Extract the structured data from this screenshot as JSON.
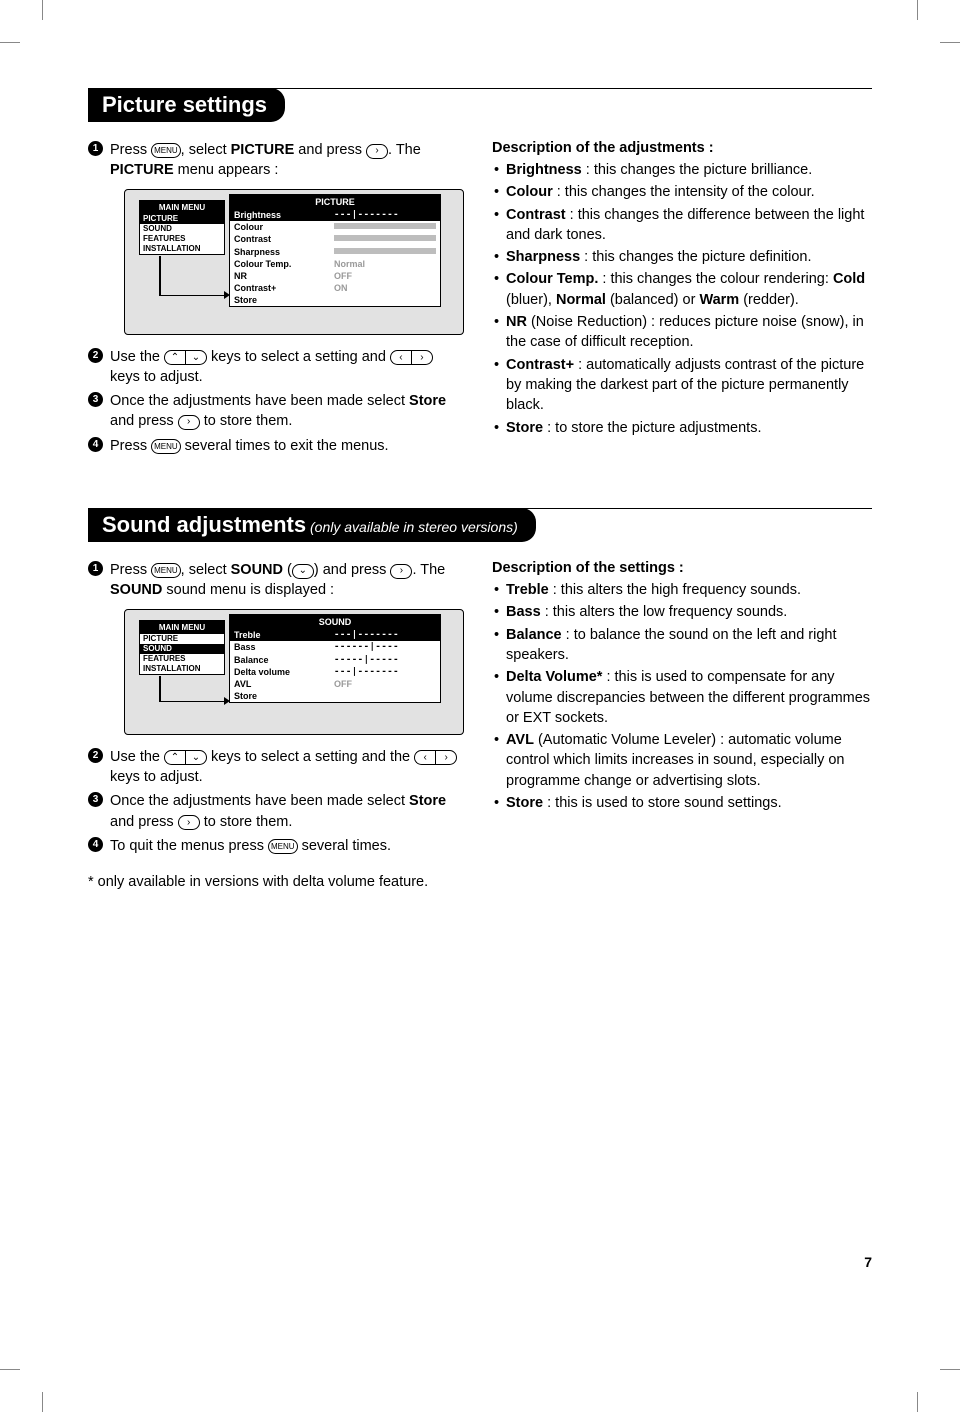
{
  "page_number": "7",
  "sections": {
    "picture": {
      "title": "Picture settings",
      "steps": {
        "s1a": "Press ",
        "s1b": ", select ",
        "s1_bold": "PICTURE",
        "s1c": " and press ",
        "s1d": ". The ",
        "s1_bold2": "PICTURE",
        "s1e": " menu appears :",
        "s2a": "Use the ",
        "s2b": " keys to select a setting and ",
        "s2c": " keys to adjust.",
        "s3a": "Once the adjustments have been made select ",
        "s3_bold": "Store",
        "s3b": " and press ",
        "s3c": " to store them.",
        "s4a": "Press ",
        "s4b": " several times to exit the menus."
      },
      "osd": {
        "main_menu_title": "MAIN MENU",
        "main_menu_items": [
          "PICTURE",
          "SOUND",
          "FEATURES",
          "INSTALLATION"
        ],
        "selected": 0,
        "panel_title": "PICTURE",
        "rows": [
          {
            "label": "Brightness",
            "type": "slider",
            "val": "---|-------",
            "sel": true
          },
          {
            "label": "Colour",
            "type": "bar"
          },
          {
            "label": "Contrast",
            "type": "bar"
          },
          {
            "label": "Sharpness",
            "type": "bar"
          },
          {
            "label": "Colour Temp.",
            "type": "text",
            "val": "Normal"
          },
          {
            "label": "NR",
            "type": "text",
            "val": "OFF"
          },
          {
            "label": "Contrast+",
            "type": "text",
            "val": "ON"
          },
          {
            "label": "Store",
            "type": "none"
          }
        ]
      },
      "desc_title": "Description of the adjustments :",
      "desc": [
        {
          "t": "Brightness",
          "d": " : this changes the picture brilliance."
        },
        {
          "t": "Colour",
          "d": " : this changes the intensity of the colour."
        },
        {
          "t": "Contrast",
          "d": " : this changes the difference between the light and dark tones."
        },
        {
          "t": "Sharpness",
          "d": " : this changes the picture definition."
        },
        {
          "t": "Colour Temp.",
          "d": " : this changes the colour rendering: Cold (bluer), Normal (balanced) or Warm (redder)."
        },
        {
          "t": "NR",
          "d": " (Noise Reduction) : reduces picture noise (snow), in the case of difficult reception."
        },
        {
          "t": "Contrast+",
          "d": " : automatically adjusts contrast of the picture by making the darkest part of the picture permanently black."
        },
        {
          "t": "Store",
          "d": " : to store the picture adjustments."
        }
      ],
      "desc_specials": {
        "4": {
          "pieces": [
            " : this changes the colour rendering: ",
            "Cold",
            " (bluer), ",
            "Normal",
            " (balanced) or ",
            "Warm",
            " (redder)."
          ]
        }
      }
    },
    "sound": {
      "title": "Sound adjustments",
      "subtitle": " (only available in stereo versions)",
      "steps": {
        "s1a": "Press ",
        "s1b": ", select ",
        "s1_bold": "SOUND",
        "s1c": " (",
        "s1d": ") and press ",
        "s1e": ". The ",
        "s1_bold2": "SOUND",
        "s1f": " sound menu is displayed :",
        "s2a": "Use the ",
        "s2b": " keys to select a setting and the ",
        "s2c": " keys to adjust.",
        "s3a": "Once the adjustments have been made select ",
        "s3_bold": "Store",
        "s3b": " and press ",
        "s3c": " to store them.",
        "s4a": "To quit the menus press ",
        "s4b": " several times."
      },
      "osd": {
        "main_menu_title": "MAIN MENU",
        "main_menu_items": [
          "PICTURE",
          "SOUND",
          "FEATURES",
          "INSTALLATION"
        ],
        "selected": 1,
        "panel_title": "SOUND",
        "rows": [
          {
            "label": "Treble",
            "type": "slider",
            "val": "---|-------",
            "sel": true
          },
          {
            "label": "Bass",
            "type": "slider",
            "val": "------|----"
          },
          {
            "label": "Balance",
            "type": "slider",
            "val": "-----|-----"
          },
          {
            "label": "Delta volume",
            "type": "slider",
            "val": "---|-------"
          },
          {
            "label": "AVL",
            "type": "text",
            "val": "OFF"
          },
          {
            "label": "Store",
            "type": "none"
          }
        ]
      },
      "desc_title": "Description of the settings :",
      "desc": [
        {
          "t": "Treble",
          "d": " : this alters the high frequency sounds."
        },
        {
          "t": "Bass",
          "d": " : this alters the low frequency sounds."
        },
        {
          "t": "Balance",
          "d": " : to balance the sound on the left and right speakers."
        },
        {
          "t": "Delta Volume*",
          "d": " : this is used to compensate for any volume discrepancies between the different programmes or EXT sockets."
        },
        {
          "t": "AVL",
          "d": " (Automatic Volume Leveler) : automatic volume control which limits increases in sound, especially on programme change or advertising slots."
        },
        {
          "t": "Store",
          "d": " : this is used to store sound settings."
        }
      ],
      "footnote": "* only available in versions with delta volume feature."
    }
  },
  "icons": {
    "menu": "MENU",
    "right": "›",
    "left": "‹",
    "up": "⌃",
    "down": "⌄"
  }
}
